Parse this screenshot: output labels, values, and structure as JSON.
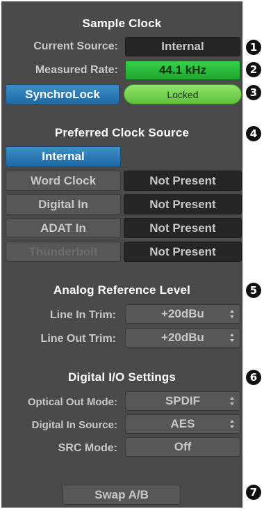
{
  "sample_clock": {
    "title": "Sample Clock",
    "current_source_label": "Current Source:",
    "current_source_value": "Internal",
    "measured_rate_label": "Measured Rate:",
    "measured_rate_value": "44.1 kHz",
    "synchrolock_label": "SynchroLock",
    "synchrolock_status": "Locked"
  },
  "preferred_clock": {
    "title": "Preferred Clock Source",
    "sources": [
      {
        "label": "Internal",
        "status": ""
      },
      {
        "label": "Word Clock",
        "status": "Not Present"
      },
      {
        "label": "Digital In",
        "status": "Not Present"
      },
      {
        "label": "ADAT In",
        "status": "Not Present"
      },
      {
        "label": "Thunderbolt",
        "status": "Not Present"
      }
    ]
  },
  "analog_ref": {
    "title": "Analog Reference Level",
    "line_in_label": "Line In Trim:",
    "line_in_value": "+20dBu",
    "line_out_label": "Line Out Trim:",
    "line_out_value": "+20dBu"
  },
  "digital_io": {
    "title": "Digital I/O Settings",
    "optical_out_label": "Optical Out Mode:",
    "optical_out_value": "SPDIF",
    "digital_in_label": "Digital In Source:",
    "digital_in_value": "AES",
    "src_mode_label": "SRC Mode:",
    "src_mode_value": "Off"
  },
  "swap_button": "Swap A/B",
  "callouts": [
    "1",
    "2",
    "3",
    "4",
    "5",
    "6",
    "7"
  ],
  "colors": {
    "panel": "#4a4a4a",
    "active_blue": "#2a7bb8",
    "rate_green": "#2ac03c",
    "locked_green": "#76d150",
    "callout_black": "#111111"
  }
}
